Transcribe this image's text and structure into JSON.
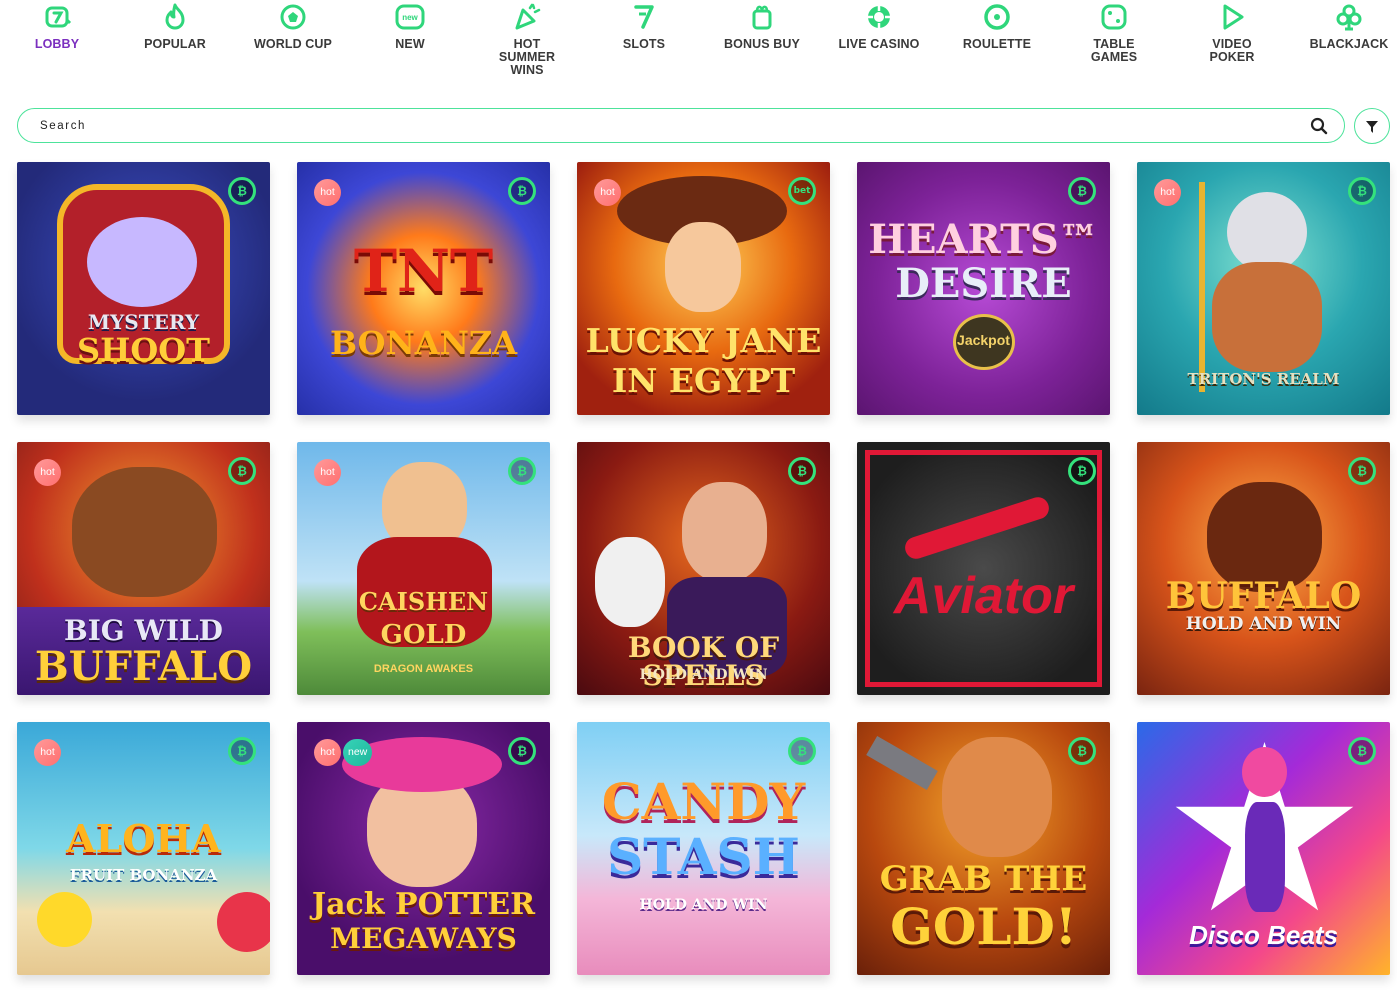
{
  "nav": {
    "items": [
      {
        "label": "LOBBY",
        "icon": "lobby-seven-icon"
      },
      {
        "label": "POPULAR",
        "icon": "flame-icon"
      },
      {
        "label": "WORLD CUP",
        "icon": "soccer-ball-icon"
      },
      {
        "label": "NEW",
        "icon": "new-tag-icon"
      },
      {
        "label": "HOT SUMMER WINS",
        "icon": "party-popper-icon"
      },
      {
        "label": "SLOTS",
        "icon": "slot-seven-icon"
      },
      {
        "label": "BONUS BUY",
        "icon": "gift-icon"
      },
      {
        "label": "LIVE CASINO",
        "icon": "casino-chip-icon"
      },
      {
        "label": "ROULETTE",
        "icon": "roulette-wheel-icon"
      },
      {
        "label": "TABLE GAMES",
        "icon": "dice-icon"
      },
      {
        "label": "VIDEO POKER",
        "icon": "play-icon"
      },
      {
        "label": "BLACKJACK",
        "icon": "club-suit-icon"
      }
    ],
    "active_color": "#7b2fbf",
    "icon_color": "#2fd67b"
  },
  "search": {
    "placeholder": "Search",
    "border_color": "#4de39b"
  },
  "badges": {
    "hot": "hot",
    "new": "new",
    "crypto": "₿"
  },
  "games": [
    {
      "title_line1": "MYSTERY",
      "title_line2": "SHOOT",
      "hot": false,
      "new": false
    },
    {
      "title_line1": "TNT",
      "title_line2": "BONANZA",
      "hot": true,
      "new": false
    },
    {
      "title_line1": "LUCKY JANE",
      "title_line2": "IN EGYPT",
      "hot": true,
      "new": false,
      "btc_label": "bet"
    },
    {
      "title_line1": "HEARTS™",
      "title_line2": "DESIRE",
      "sub": "Jackpot",
      "hot": false,
      "new": false
    },
    {
      "title_line1": "TRITON'S REALM",
      "title_line2": "",
      "hot": true,
      "new": false
    },
    {
      "title_line1": "BIG WILD",
      "title_line2": "BUFFALO",
      "hot": true,
      "new": false
    },
    {
      "title_line1": "CAISHEN",
      "title_line2": "GOLD",
      "sub": "DRAGON AWAKES",
      "hot": true,
      "new": false
    },
    {
      "title_line1": "BOOK OF SPELLS",
      "title_line2": "HOLD AND WIN",
      "hot": false,
      "new": false
    },
    {
      "title_line1": "Aviator",
      "title_line2": "",
      "hot": false,
      "new": false
    },
    {
      "title_line1": "BUFFALO",
      "title_line2": "HOLD AND WIN",
      "hot": false,
      "new": false
    },
    {
      "title_line1": "ALOHA",
      "title_line2": "FRUIT BONANZA",
      "hot": true,
      "new": false
    },
    {
      "title_line1": "Jack POTTER",
      "title_line2": "MEGAWAYS",
      "hot": true,
      "new": true
    },
    {
      "title_line1": "CANDY",
      "title_line2": "STASH",
      "sub": "HOLD AND WIN",
      "hot": false,
      "new": false
    },
    {
      "title_line1": "GRAB THE",
      "title_line2": "GOLD!",
      "hot": false,
      "new": false
    },
    {
      "title_line1": "Disco Beats",
      "title_line2": "",
      "hot": false,
      "new": false
    }
  ]
}
